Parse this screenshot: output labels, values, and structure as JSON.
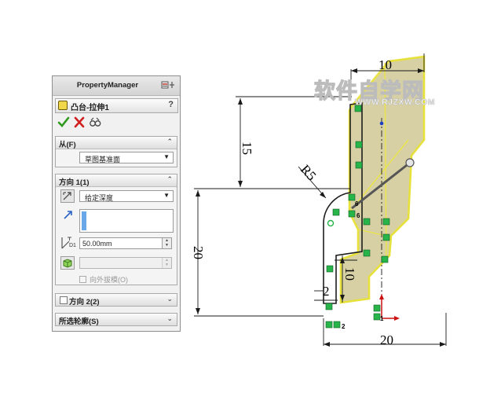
{
  "property_manager": {
    "title": "PropertyManager",
    "feature_title": "凸台-拉伸1",
    "help": "?",
    "from_group": {
      "label": "从(F)",
      "selected": "草图基准面"
    },
    "direction1": {
      "label": "方向 1(1)",
      "end_condition": "给定深度",
      "depth": "50.00mm",
      "depth_icon_label": "D1",
      "draft_outward_label": "向外拔模(O)"
    },
    "direction2": {
      "label": "方向 2(2)"
    },
    "selected_contours": {
      "label": "所选轮廓(S)"
    }
  },
  "viewport": {
    "watermark_title": "软件自学网",
    "watermark_url": "WWW.RJZXW.COM",
    "dimensions": {
      "top_width": "10",
      "vertical_upper": "15",
      "radius": "R5",
      "vertical_total": "20",
      "step_height": "10",
      "step_width": "2",
      "bottom_width": "20"
    },
    "relation_marks": {
      "n6a": "6",
      "n6b": "6",
      "n2": "2",
      "n1": "1"
    }
  }
}
